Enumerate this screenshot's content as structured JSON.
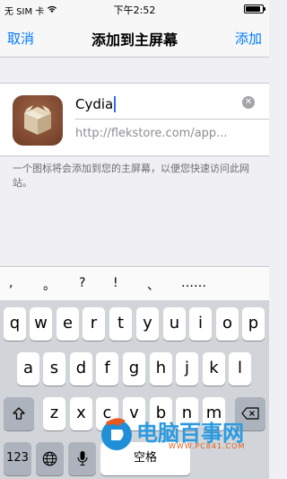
{
  "status_bar": {
    "carrier": "无 SIM 卡",
    "time": "下午2:52",
    "icons": [
      "wifi-icon",
      "battery-icon"
    ],
    "battery_level": 0.9
  },
  "nav": {
    "cancel_label": "取消",
    "title": "添加到主屏幕",
    "add_label": "添加"
  },
  "bookmark": {
    "icon": "cydia-box-icon",
    "name_value": "Cydia",
    "url_value": "http://flekstore.com/app..."
  },
  "description": "一个图标将会添加到您的主屏幕，以便您快速访问此网站。",
  "suggestions": [
    ",",
    "。",
    "?",
    "!",
    "、",
    "……"
  ],
  "keyboard": {
    "row1": [
      "q",
      "w",
      "e",
      "r",
      "t",
      "y",
      "u",
      "i",
      "o",
      "p"
    ],
    "row2": [
      "a",
      "s",
      "d",
      "f",
      "g",
      "h",
      "j",
      "k",
      "l"
    ],
    "row3": [
      "z",
      "x",
      "c",
      "v",
      "b",
      "n",
      "m"
    ],
    "numbers_label": "123",
    "space_label": "空格",
    "icons": [
      "shift-icon",
      "backspace-icon",
      "globe-icon",
      "microphone-icon"
    ]
  },
  "watermark": {
    "text": "电脑百事网",
    "url": "WWW.PC841.COM"
  },
  "colors": {
    "accent": "#007aff",
    "background": "#efeff4",
    "keyboard": "#d1d4d9",
    "icon_brown": "#8b4e33"
  }
}
